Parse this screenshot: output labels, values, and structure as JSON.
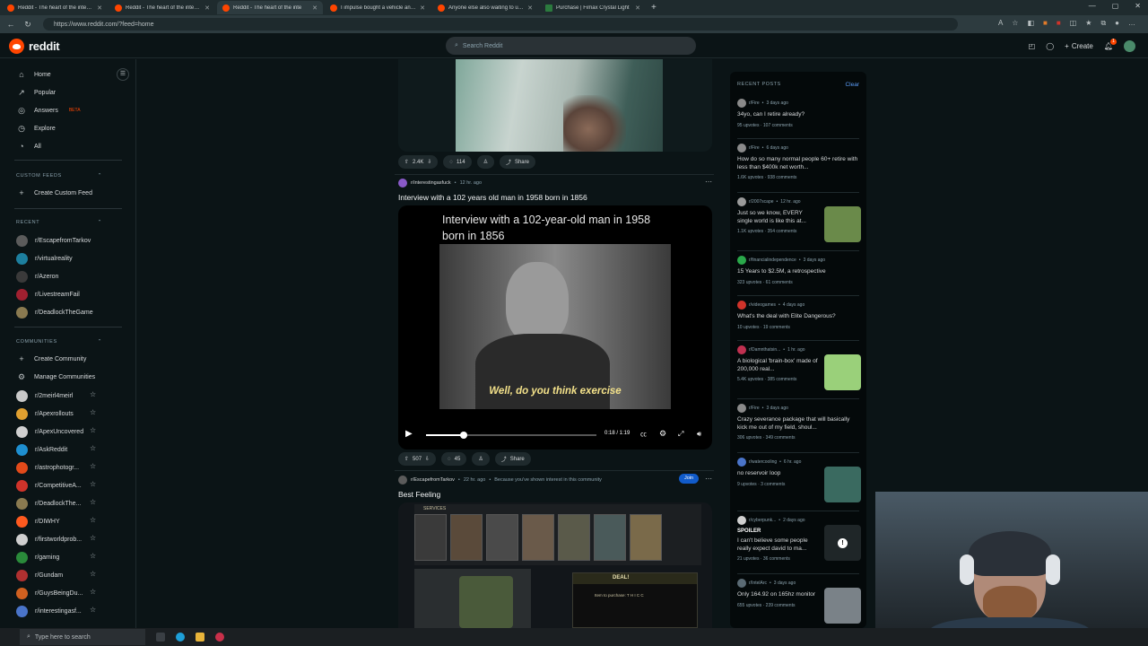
{
  "browser": {
    "tabs": [
      {
        "title": "Reddit - The heart of the internet",
        "fav": "reddit",
        "active": false
      },
      {
        "title": "Reddit - The heart of the internet",
        "fav": "reddit",
        "active": false
      },
      {
        "title": "Reddit - The heart of the inte",
        "fav": "reddit",
        "active": true
      },
      {
        "title": "I impulse bought a vehicle and I",
        "fav": "reddit",
        "active": false
      },
      {
        "title": "Anyone else also waiting to upg",
        "fav": "reddit",
        "active": false
      },
      {
        "title": "Purchase | Fimax Crystal Light",
        "fav": "site",
        "active": false
      }
    ],
    "url": "https://www.reddit.com/?feed=home"
  },
  "header": {
    "logo_text": "reddit",
    "search_placeholder": "Search Reddit",
    "create_label": "Create",
    "notif_count": "1"
  },
  "sidebar": {
    "main": [
      {
        "label": "Home",
        "icon": "home-icon",
        "glyph": "⌂"
      },
      {
        "label": "Popular",
        "icon": "popular-icon",
        "glyph": "↗"
      },
      {
        "label": "Answers",
        "icon": "answers-icon",
        "glyph": "◎",
        "badge": "BETA"
      },
      {
        "label": "Explore",
        "icon": "explore-icon",
        "glyph": "◷"
      },
      {
        "label": "All",
        "icon": "all-icon",
        "glyph": "◔"
      }
    ],
    "custom_feeds_title": "CUSTOM FEEDS",
    "create_custom_feed": "Create Custom Feed",
    "recent_title": "RECENT",
    "recent": [
      {
        "label": "r/EscapefromTarkov",
        "color": "#5b5b5b"
      },
      {
        "label": "r/virtualreality",
        "color": "#1d7f9e"
      },
      {
        "label": "r/Azeron",
        "color": "#3a3a3a"
      },
      {
        "label": "r/LivestreamFail",
        "color": "#a02030"
      },
      {
        "label": "r/DeadlockTheGame",
        "color": "#8a7a50"
      }
    ],
    "communities_title": "COMMUNITIES",
    "create_community": "Create Community",
    "manage_communities": "Manage Communities",
    "communities": [
      {
        "label": "r/2meirl4meirl",
        "color": "#c9c9c9"
      },
      {
        "label": "r/Apexrollouts",
        "color": "#e0a030"
      },
      {
        "label": "r/ApexUncovered",
        "color": "#d0d0d0"
      },
      {
        "label": "r/AskReddit",
        "color": "#1e8fd0"
      },
      {
        "label": "r/astrophotogr...",
        "color": "#e24a1a"
      },
      {
        "label": "r/CompetitiveA...",
        "color": "#d0332a"
      },
      {
        "label": "r/DeadlockThe...",
        "color": "#8a7a50"
      },
      {
        "label": "r/DIWHY",
        "color": "#ff5a1f"
      },
      {
        "label": "r/firstworldprob...",
        "color": "#cfcfcf"
      },
      {
        "label": "r/gaming",
        "color": "#2a8a3a"
      },
      {
        "label": "r/Gundam",
        "color": "#b03030"
      },
      {
        "label": "r/GuysBeingDu...",
        "color": "#d06020"
      },
      {
        "label": "r/interestingasf...",
        "color": "#4a74c9"
      }
    ]
  },
  "feed": {
    "post1": {
      "upvotes": "2.4K",
      "comments": "114",
      "share": "Share"
    },
    "post2": {
      "subreddit": "r/interestingasfuck",
      "age": "12 hr. ago",
      "title": "Interview with a 102 years old man in 1958 born in 1856",
      "video_caption_title": "Interview with a 102-year-old man in 1958 born in 1856",
      "subtitle": "Well, do you think exercise",
      "time": "0:18 / 1:19",
      "progress": 0.22,
      "upvotes": "507",
      "comments": "45",
      "share": "Share"
    },
    "post3": {
      "subreddit": "r/EscapefromTarkov",
      "age": "22 hr. ago",
      "reason": "Because you've shown interest in this community",
      "join": "Join",
      "title": "Best Feeling",
      "services_label": "SERVICES",
      "deal_label": "DEAL!",
      "purchase_label": "Item to purchase: T H I C C"
    }
  },
  "recent_posts": {
    "title": "RECENT POSTS",
    "clear": "Clear",
    "items": [
      {
        "sub": "r/Fire",
        "age": "3 days ago",
        "title": "34yo, can I retire already?",
        "stats": "95 upvotes · 107 comments",
        "avatar": "#8a8a8a"
      },
      {
        "sub": "r/Fire",
        "age": "6 days ago",
        "title": "How do so many normal people 60+ retire with less than $400k net worth...",
        "stats": "1.6K upvotes · 938 comments",
        "avatar": "#8a8a8a"
      },
      {
        "sub": "r/2007scape",
        "age": "12 hr. ago",
        "title": "Just so we know, EVERY single world is like this at...",
        "stats": "1.1K upvotes · 354 comments",
        "avatar": "#9a9a9a",
        "thumb": "#6a8a4a"
      },
      {
        "sub": "r/financialindependence",
        "age": "3 days ago",
        "title": "15 Years to $2.5M, a retrospective",
        "stats": "323 upvotes · 61 comments",
        "avatar": "#2aa84a"
      },
      {
        "sub": "r/videogames",
        "age": "4 days ago",
        "title": "What's the deal with Elite Dangerous?",
        "stats": "10 upvotes · 19 comments",
        "avatar": "#d0332a"
      },
      {
        "sub": "r/Damnthatsin...",
        "age": "1 hr. ago",
        "title": "A biological 'brain-box' made of 200,000 real...",
        "stats": "5.4K upvotes · 385 comments",
        "avatar": "#c03050",
        "thumb": "#9ad07a"
      },
      {
        "sub": "r/Fire",
        "age": "3 days ago",
        "title": "Crazy severance package that will basically kick me out of my field, shoul...",
        "stats": "306 upvotes · 349 comments",
        "avatar": "#8a8a8a"
      },
      {
        "sub": "r/watercooling",
        "age": "6 hr. ago",
        "title": "no reservoir loop",
        "stats": "9 upvotes · 3 comments",
        "avatar": "#4a74c9",
        "thumb": "#3a6a60"
      },
      {
        "sub": "r/cyberpunk...",
        "age": "2 days ago",
        "spoiler": "SPOILER",
        "title": "I can't believe some people really expect david to ma...",
        "stats": "21 upvotes · 36 comments",
        "avatar": "#d0d0d0",
        "thumb": "#1f2628"
      },
      {
        "sub": "r/IntelArc",
        "age": "3 days ago",
        "title": "Only 164.92 on 165hz monitor",
        "stats": "655 upvotes · 239 comments",
        "avatar": "#5a6a74",
        "thumb": "#7a8288"
      }
    ]
  },
  "taskbar": {
    "search_placeholder": "Type here to search"
  }
}
